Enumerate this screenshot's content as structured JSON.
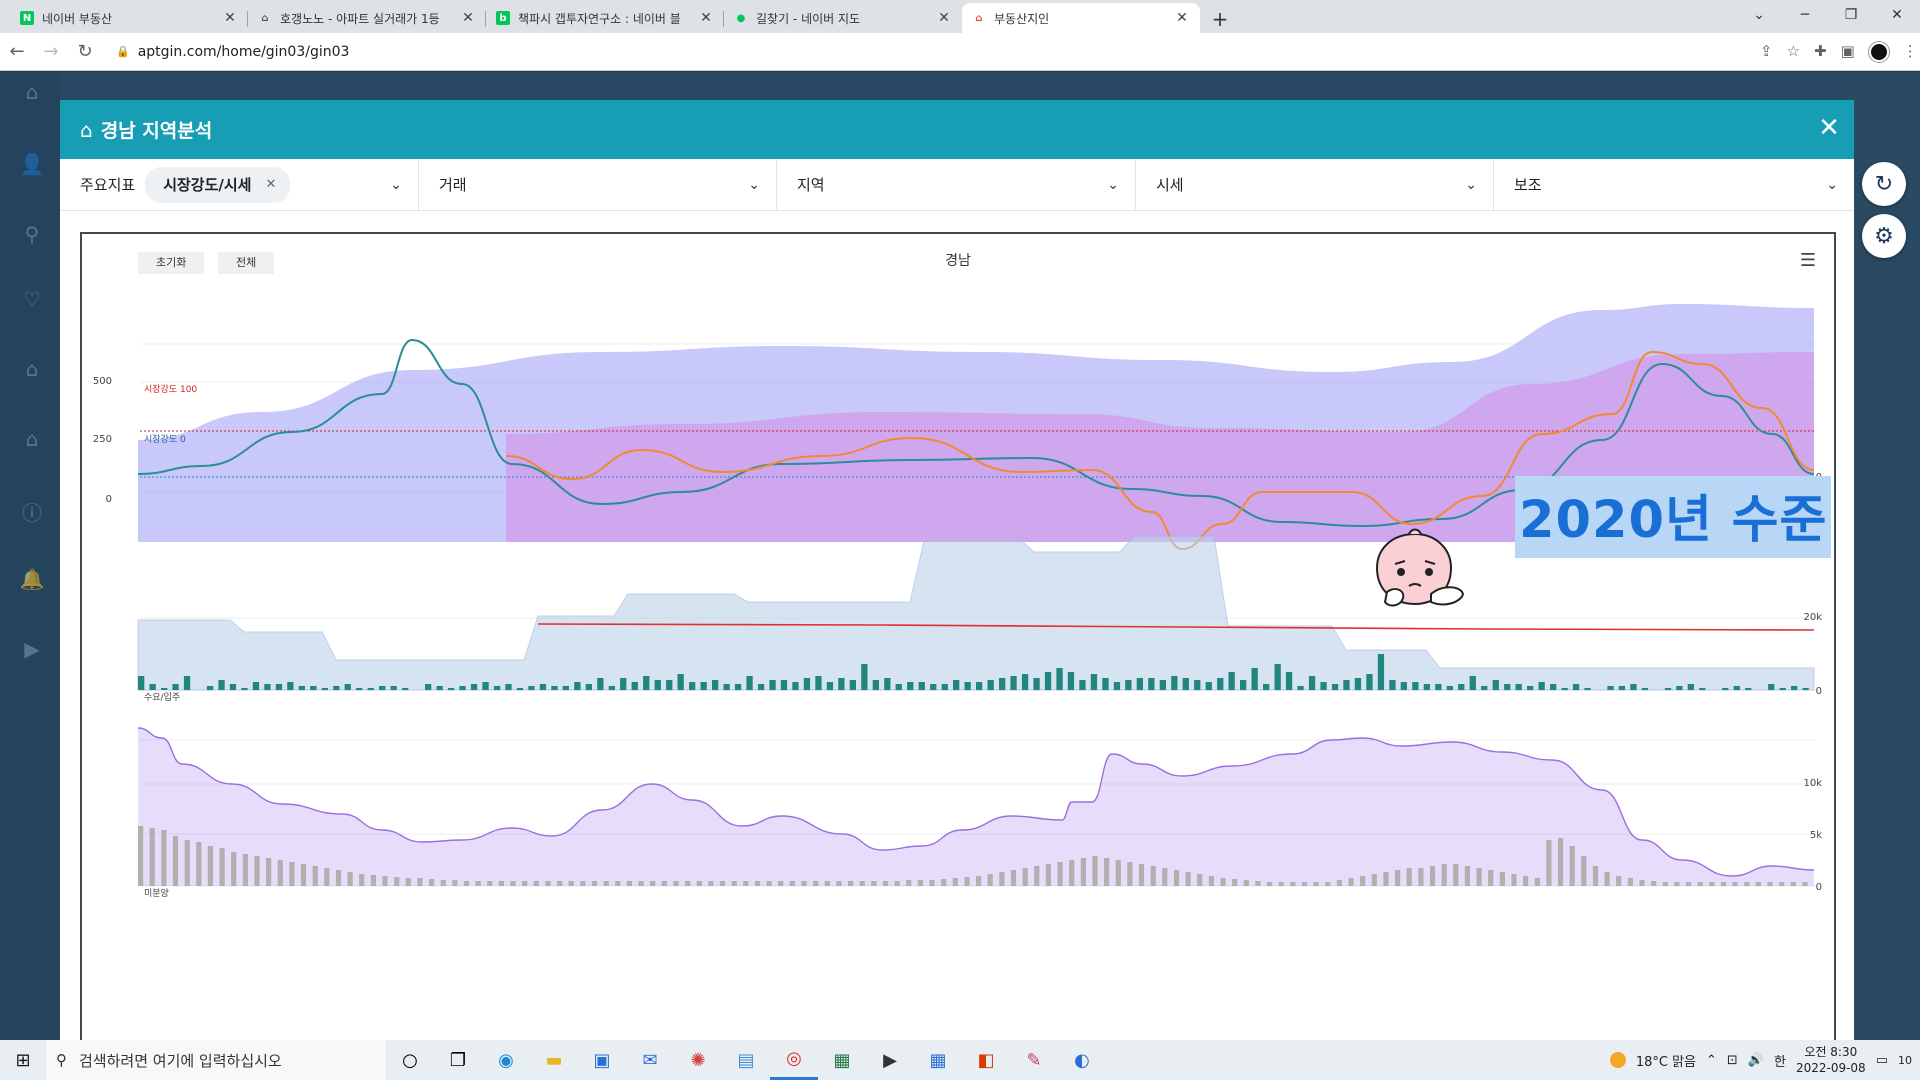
{
  "browser": {
    "tabs": [
      {
        "title": "네이버 부동산",
        "fav": "N",
        "favcolor": "#03c75a"
      },
      {
        "title": "호갱노노 - 아파트 실거래가 1등",
        "fav": "⌂",
        "favcolor": "#555555"
      },
      {
        "title": "책파시 갭투자연구소 : 네이버 블",
        "fav": "b",
        "favcolor": "#03c75a"
      },
      {
        "title": "길찾기 - 네이버 지도",
        "fav": "●",
        "favcolor": "#03c75a"
      },
      {
        "title": "부동산지인",
        "fav": "⌂",
        "favcolor": "#e04a2f"
      }
    ],
    "url": "aptgin.com/home/gin03/gin03"
  },
  "modal": {
    "title": "경남 지역분석",
    "filters": {
      "main_label": "주요지표",
      "chip": "시장강도/시세",
      "trade": "거래",
      "region": "지역",
      "price": "시세",
      "aux": "보조"
    }
  },
  "chart": {
    "title": "경남",
    "reset_button": "초기화",
    "all_button": "전체",
    "overlay_text": "2020년 수준",
    "y_ticks_top": [
      "500",
      "250",
      "0"
    ],
    "ref_line_high": "시장강도 100",
    "ref_line_low": "시장강도 0",
    "right_zero_top": "0",
    "y_ticks_mid": [
      "20k",
      "0"
    ],
    "mid_label": "수요/입주",
    "y_ticks_bot": [
      "10k",
      "5k",
      "0"
    ],
    "bot_label": "미분양",
    "colors": {
      "area_blue": "#9a9cf5",
      "area_pink": "#d68be3",
      "line_teal": "#2c8c98",
      "line_orange": "#f08a32",
      "step_blue": "#bcd3ea",
      "bar_teal": "#23857f",
      "bar_grey": "#b0b0b0",
      "area_purple": "#b99af0",
      "red_line": "#e03030"
    }
  },
  "taskbar": {
    "search_placeholder": "검색하려면 여기에 입력하십시오",
    "weather": "18°C  맑음",
    "time": "오전 8:30",
    "date": "2022-09-08",
    "notif": "10"
  }
}
